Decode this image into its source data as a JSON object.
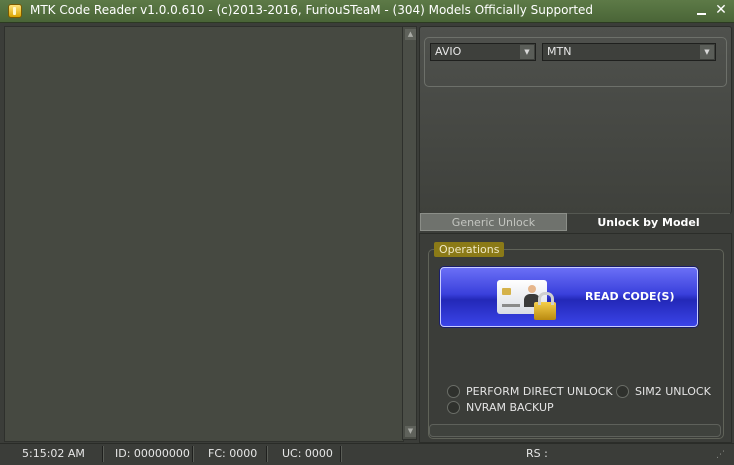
{
  "window": {
    "title": "MTK Code Reader v1.0.0.610 - (c)2013-2016, FuriouSTeaM - (304) Models Officially Supported",
    "minimize_label": "",
    "close_label": "✕"
  },
  "model": {
    "brand": "AVIO",
    "carrier": "MTN"
  },
  "tabs": [
    {
      "label": "Generic Unlock",
      "active": false
    },
    {
      "label": "Unlock by Model",
      "active": true
    }
  ],
  "operations": {
    "legend": "Operations",
    "read_button_label": "READ CODE(S)",
    "options": [
      {
        "label": "PERFORM DIRECT UNLOCK",
        "checked": false
      },
      {
        "label": "SIM2 UNLOCK",
        "checked": false
      },
      {
        "label": "NVRAM BACKUP",
        "checked": false
      }
    ]
  },
  "statusbar": {
    "time": "5:15:02 AM",
    "id": "ID: 00000000",
    "fc": "FC: 0000",
    "uc": "UC: 0000",
    "rs": "RS :"
  },
  "colors": {
    "titlebar": "#4a6537",
    "read_button": "#3a40dc",
    "legend": "#8b7a17"
  }
}
